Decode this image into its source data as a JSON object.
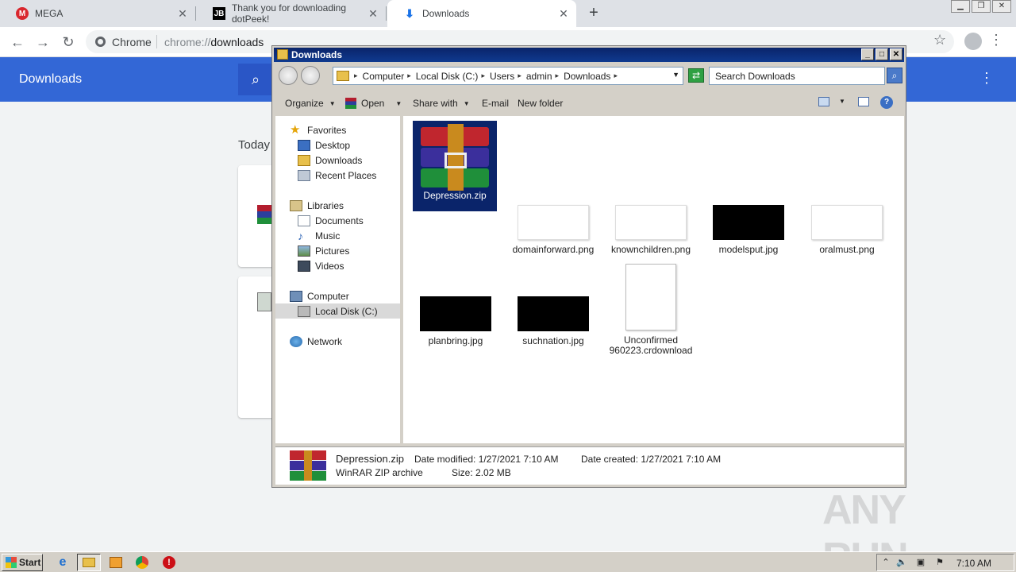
{
  "browser": {
    "tabs": [
      {
        "label": "MEGA",
        "favicon": "mega-icon"
      },
      {
        "label": "Thank you for downloading dotPeek!",
        "favicon": "jetbrains-icon"
      },
      {
        "label": "Downloads",
        "favicon": "download-icon"
      }
    ],
    "omnibox": {
      "label": "Chrome",
      "url_prefix": "chrome://",
      "url_host": "downloads"
    },
    "page": {
      "title": "Downloads",
      "section": "Today"
    }
  },
  "explorer": {
    "title": "Downloads",
    "breadcrumb": [
      "Computer",
      "Local Disk (C:)",
      "Users",
      "admin",
      "Downloads"
    ],
    "search_placeholder": "Search Downloads",
    "commands": {
      "organize": "Organize",
      "open": "Open",
      "share_with": "Share with",
      "email": "E-mail",
      "new_folder": "New folder"
    },
    "nav": {
      "favorites": "Favorites",
      "desktop": "Desktop",
      "downloads": "Downloads",
      "recent": "Recent Places",
      "libraries": "Libraries",
      "documents": "Documents",
      "music": "Music",
      "pictures": "Pictures",
      "videos": "Videos",
      "computer": "Computer",
      "local_disk": "Local Disk (C:)",
      "network": "Network"
    },
    "files": [
      {
        "name": "Depression.zip",
        "kind": "winrar-zip",
        "selected": true
      },
      {
        "name": "domainforward.png",
        "kind": "image-white"
      },
      {
        "name": "knownchildren.png",
        "kind": "image-white"
      },
      {
        "name": "modelsput.jpg",
        "kind": "image-black"
      },
      {
        "name": "oralmust.png",
        "kind": "image-white"
      },
      {
        "name": "planbring.jpg",
        "kind": "image-black"
      },
      {
        "name": "suchnation.jpg",
        "kind": "image-black"
      },
      {
        "name": "Unconfirmed 960223.crdownload",
        "kind": "blank-file"
      }
    ],
    "details": {
      "name": "Depression.zip",
      "type": "WinRAR ZIP archive",
      "date_modified_label": "Date modified:",
      "date_modified": "1/27/2021 7:10 AM",
      "date_created_label": "Date created:",
      "date_created": "1/27/2021 7:10 AM",
      "size_label": "Size:",
      "size": "2.02 MB"
    }
  },
  "taskbar": {
    "start": "Start",
    "clock": "7:10 AM"
  },
  "watermark": "ANY RUN"
}
